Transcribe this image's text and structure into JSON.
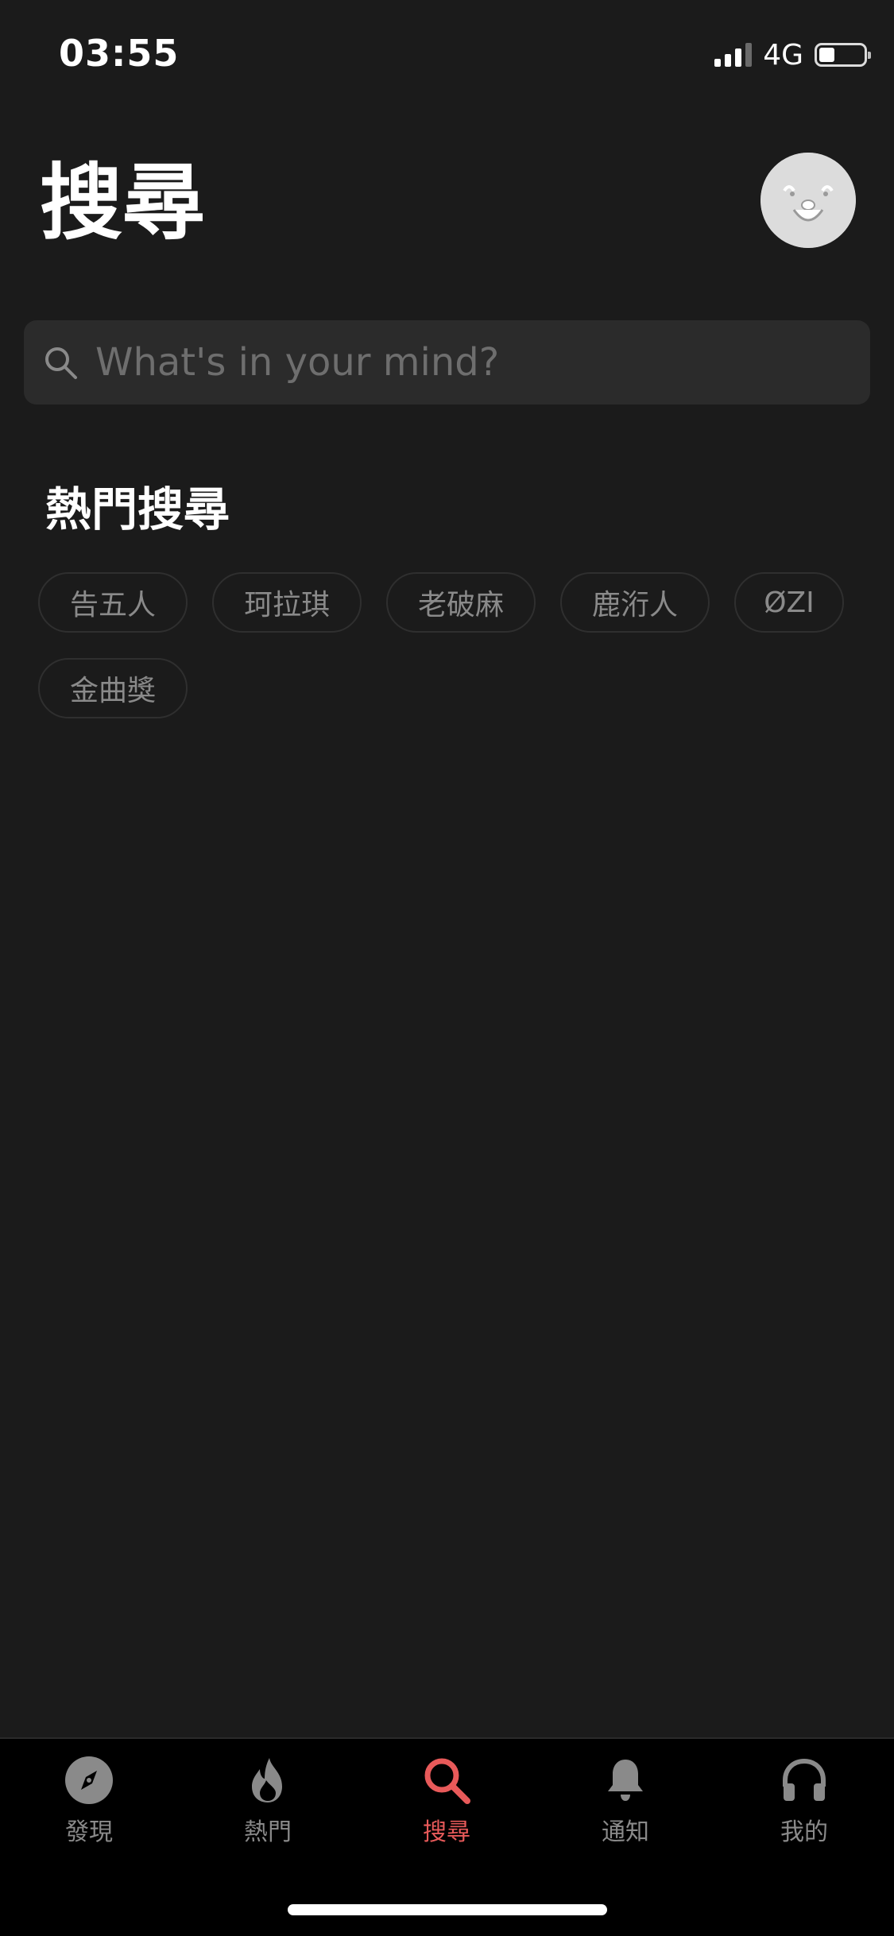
{
  "status_bar": {
    "time": "03:55",
    "network": "4G",
    "battery_level": 0.35
  },
  "header": {
    "title": "搜尋",
    "avatar_icon": "profile-avatar"
  },
  "search": {
    "placeholder": "What's in your mind?",
    "value": "",
    "icon": "search-icon"
  },
  "hot_search": {
    "title": "熱門搜尋",
    "chips": [
      {
        "label": "告五人"
      },
      {
        "label": "珂拉琪"
      },
      {
        "label": "老破麻"
      },
      {
        "label": "鹿洐人"
      },
      {
        "label": "ØZI"
      },
      {
        "label": "金曲獎"
      }
    ]
  },
  "tab_bar": {
    "active": "搜尋",
    "accent_color": "#e85a5a",
    "items": [
      {
        "label": "發現",
        "icon": "compass-icon"
      },
      {
        "label": "熱門",
        "icon": "fire-icon"
      },
      {
        "label": "搜尋",
        "icon": "search-icon"
      },
      {
        "label": "通知",
        "icon": "bell-icon"
      },
      {
        "label": "我的",
        "icon": "headphones-icon"
      }
    ]
  }
}
